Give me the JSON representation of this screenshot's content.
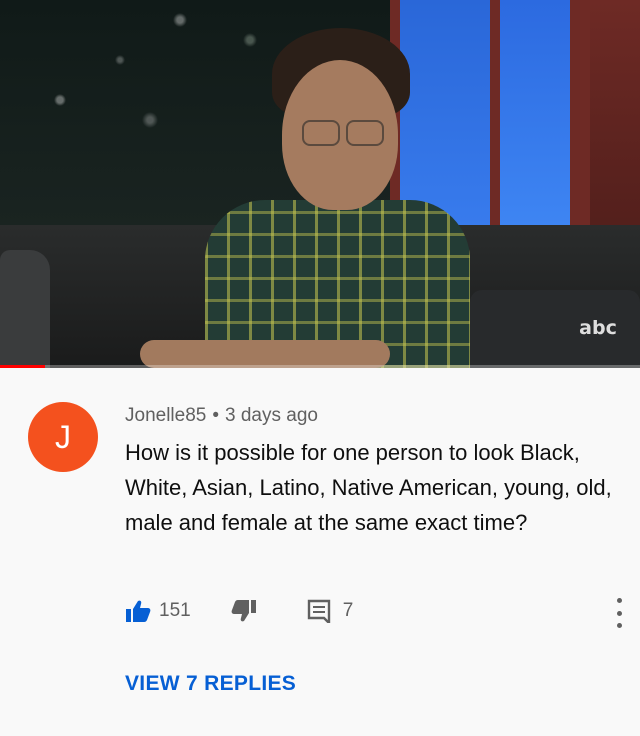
{
  "video": {
    "channel_logo": "abc",
    "progress_fraction": 0.07,
    "accent_color": "#ff0000"
  },
  "comment": {
    "avatar_letter": "J",
    "avatar_color": "#f4511e",
    "author": "Jonelle85",
    "separator": "•",
    "time": "3 days ago",
    "text": "How is it possible for one person to look Black, White, Asian, Latino, Native American, young, old, male and female at the same exact time?",
    "like_count": "151",
    "reply_count": "7",
    "icons": [
      "thumbs-up-icon",
      "thumbs-down-icon",
      "comment-icon",
      "more-vert-icon"
    ],
    "view_replies_label": "VIEW 7 REPLIES",
    "link_color": "#065fd4"
  }
}
